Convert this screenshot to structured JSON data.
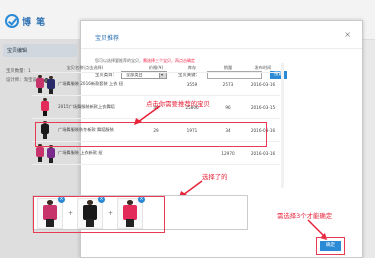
{
  "app": {
    "logo_text": "博 笔",
    "sidebar": {
      "active_tab": "宝贝编辑",
      "lines": [
        "宝贝数量：1",
        "设计师：淘宝设计"
      ]
    }
  },
  "dialog": {
    "title": "宝贝推荐",
    "close_label": "×",
    "hint_prefix": "您可以选择要推荐的宝贝，",
    "hint_warn": "需选择三个宝贝，再点击确定",
    "category_label": "宝贝类目：",
    "category_value": "全部类目",
    "keyword_label": "宝贝关键：",
    "keyword_value": "",
    "search_label": "搜索",
    "confirm_label": "确定"
  },
  "table": {
    "headers": [
      "宝贝名称(点击选择)",
      "价格(¥)",
      "库存",
      "销量",
      "发布时间"
    ],
    "rows": [
      {
        "name": "广场舞服装 2016新款套装 上衣 纽",
        "price": "",
        "stock": "3559",
        "sales": "2573",
        "time": "2016-03-16"
      },
      {
        "name": "2015广场舞服装新款上衣舞蹈",
        "price": "38",
        "stock": "25806",
        "sales": "96",
        "time": "2016-03-15"
      },
      {
        "name": "广场舞服装秋冬新款 舞蹈服装",
        "price": "29",
        "stock": "1971",
        "sales": "34",
        "time": "2016-03-16"
      },
      {
        "name": "广场舞服装 上衣新款 纽",
        "price": "",
        "stock": "",
        "sales": "12970",
        "time": "2016-03-16"
      }
    ]
  },
  "annotations": {
    "click_product": "点击你需要推荐的宝贝",
    "selected": "选择了的",
    "need_three": "需选择3个才能确定"
  },
  "colors": {
    "accent": "#2a8ad6",
    "annotation": "#e8243a"
  }
}
